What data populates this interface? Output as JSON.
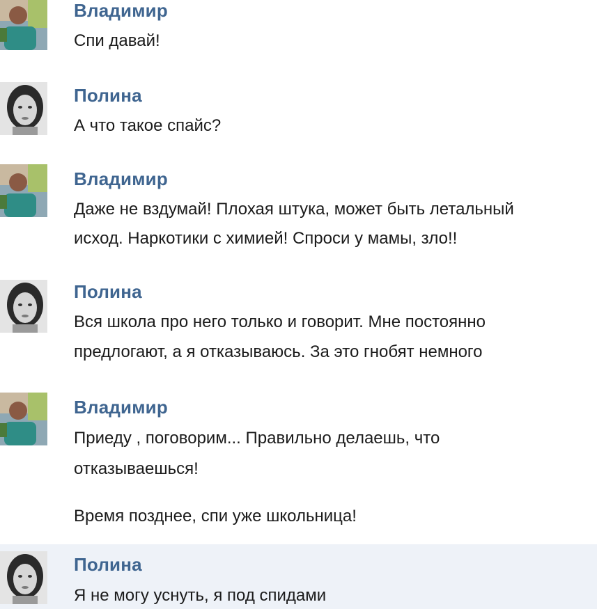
{
  "messages": [
    {
      "author": "Владимир",
      "avatar_icon": "vladimir-avatar-photo",
      "lines": [
        "Спи давай!"
      ]
    },
    {
      "author": "Полина",
      "avatar_icon": "polina-avatar-photo",
      "lines": [
        "А что такое спайс?"
      ]
    },
    {
      "author": "Владимир",
      "avatar_icon": "vladimir-avatar-photo",
      "lines": [
        "Даже не вздумай! Плохая штука, может быть летальный",
        "исход. Наркотики с химией! Спроси у мамы, зло!!"
      ]
    },
    {
      "author": "Полина",
      "avatar_icon": "polina-avatar-photo",
      "lines": [
        "Вся школа про него только и говорит. Мне постоянно",
        "предлогают, а я отказываюсь. За это гнобят немного"
      ]
    },
    {
      "author": "Владимир",
      "avatar_icon": "vladimir-avatar-photo",
      "lines": [
        "Приеду , поговорим... Правильно делаешь, что",
        "отказываешься!",
        "Время позднее, спи уже школьница!"
      ]
    },
    {
      "author": "Полина",
      "avatar_icon": "polina-avatar-photo",
      "lines": [
        "Я не могу уснуть, я под спидами"
      ]
    }
  ],
  "colors": {
    "author": "#3f6590",
    "text": "#1b1b1b",
    "highlight_bg": "#eef2f8"
  }
}
